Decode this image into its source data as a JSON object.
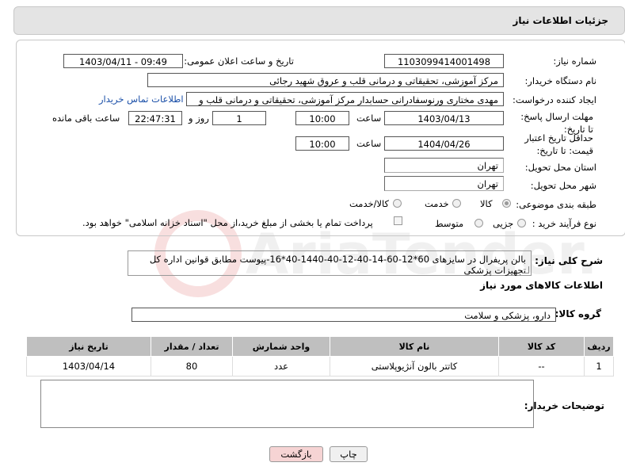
{
  "header": {
    "title": "جزئیات اطلاعات نیاز"
  },
  "form": {
    "need_number_label": "شماره نیاز:",
    "need_number": "1103099414001498",
    "announce_label": "تاریخ و ساعت اعلان عمومی:",
    "announce_value": "1403/04/11 - 09:49",
    "buyer_label": "نام دستگاه خریدار:",
    "buyer_value": "مرکز آموزشی، تحقیقاتی و درمانی قلب و عروق شهید رجائی",
    "creator_label": "ایجاد کننده درخواست:",
    "creator_value": "مهدی مختاری ورنوسفادرانی حسابدار مرکز آموزشی، تحقیقاتی و درمانی قلب و",
    "contact_link": "اطلاعات تماس خریدار",
    "send_deadline_label": "مهلت ارسال پاسخ: تا تاریخ:",
    "send_date": "1403/04/13",
    "time_label": "ساعت",
    "send_time": "10:00",
    "days_value": "1",
    "days_label": "روز و",
    "remaining_time": "22:47:31",
    "remaining_label": "ساعت باقی مانده",
    "price_validity_label": "حداقل تاریخ اعتبار قیمت: تا تاریخ:",
    "price_date": "1404/04/26",
    "price_time": "10:00",
    "province_label": "استان محل تحویل:",
    "province_value": "تهران",
    "city_label": "شهر محل تحویل:",
    "city_value": "تهران",
    "category_label": "طبقه بندی موضوعی:",
    "category_options": [
      "کالا",
      "خدمت",
      "کالا/خدمت"
    ],
    "category_selected": "کالا",
    "process_label": "نوع فرآیند خرید :",
    "process_options": [
      "جزیی",
      "متوسط"
    ],
    "payment_text": "پرداخت تمام یا بخشی از مبلغ خرید،از محل \"اسناد خزانه اسلامی\" خواهد بود."
  },
  "general_desc": {
    "label": "شرح کلی نیاز:",
    "value": "بالن پریفرال در سایزهای 60*12-60-14-40-12-40-1440-40*16-پیوست مطابق قوانین اداره کل تجهیزات پزشکی"
  },
  "goods_info": {
    "title": "اطلاعات کالاهای مورد نیاز",
    "group_label": "گروه کالا:",
    "group_value": "دارو، پزشکی و سلامت"
  },
  "table": {
    "headers": [
      "ردیف",
      "کد کالا",
      "نام کالا",
      "واحد شمارش",
      "تعداد / مقدار",
      "تاریخ نیاز"
    ],
    "rows": [
      [
        "1",
        "--",
        "کاتتر بالون آنژیوپلاستی",
        "عدد",
        "80",
        "1403/04/14"
      ]
    ]
  },
  "buyer_notes": {
    "label": "توضیحات خریدار:",
    "value": ""
  },
  "buttons": {
    "print": "چاپ",
    "back": "بازگشت"
  },
  "colors": {
    "back_button_bg": "#f6d4d4",
    "link": "#1a4fa8",
    "table_header": "#bfbfbf"
  }
}
